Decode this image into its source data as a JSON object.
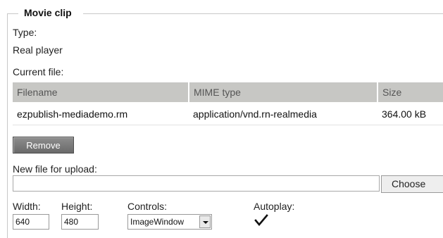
{
  "fieldset": {
    "legend": "Movie clip"
  },
  "type": {
    "label": "Type:",
    "value": "Real player"
  },
  "current_file": {
    "label": "Current file:",
    "columns": [
      "Filename",
      "MIME type",
      "Size"
    ],
    "rows": [
      [
        "ezpublish-mediademo.rm",
        "application/vnd.rn-realmedia",
        "364.00 kB"
      ]
    ]
  },
  "remove_button": {
    "label": "Remove"
  },
  "upload": {
    "label": "New file for upload:",
    "value": "",
    "choose_label": "Choose"
  },
  "width": {
    "label": "Width:",
    "value": "640"
  },
  "height": {
    "label": "Height:",
    "value": "480"
  },
  "controls": {
    "label": "Controls:",
    "selected": "ImageWindow"
  },
  "autoplay": {
    "label": "Autoplay:",
    "checked": true
  }
}
